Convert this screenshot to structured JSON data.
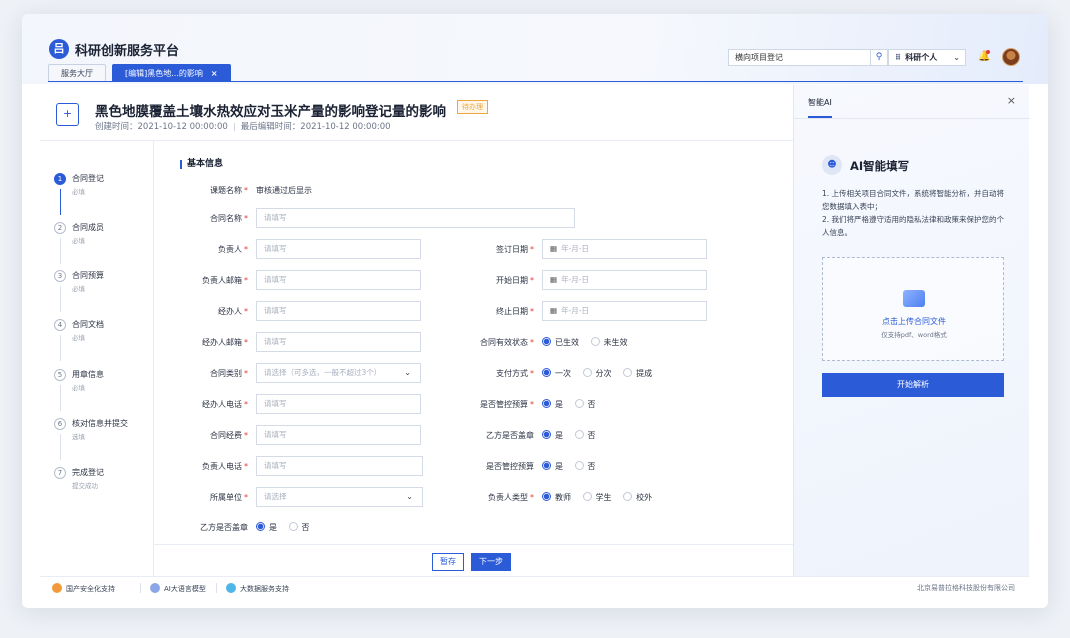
{
  "app": {
    "title": "科研创新服务平台",
    "logo_glyph": "吕"
  },
  "tabs": [
    {
      "label": "服务大厅"
    },
    {
      "label": "[编辑]黑色地...的影响",
      "close": "×"
    }
  ],
  "header": {
    "search_value": "横向项目登记",
    "search_icon": "search-icon",
    "user_label": "科研个人",
    "grid_glyph": "⠿",
    "chevron": "⌄"
  },
  "page": {
    "title": "黑色地膜覆盖土壤水热效应对玉米产量的影响登记量的影响",
    "badge": "待办理",
    "created": "创建时间：2021-10-12 00:00:00",
    "edited": "最后编辑时间：2021-10-12 00:00:00"
  },
  "steps": [
    {
      "num": "1",
      "label": "合同登记",
      "sub": "必填"
    },
    {
      "num": "2",
      "label": "合同成员",
      "sub": "必填"
    },
    {
      "num": "3",
      "label": "合同预算",
      "sub": "必填"
    },
    {
      "num": "4",
      "label": "合同文档",
      "sub": "必填"
    },
    {
      "num": "5",
      "label": "用章信息",
      "sub": "必填"
    },
    {
      "num": "6",
      "label": "核对信息并提交",
      "sub": "选填"
    },
    {
      "num": "7",
      "label": "完成登记",
      "sub": "提交成功"
    }
  ],
  "form": {
    "section": "基本信息",
    "req": "*",
    "topic_label": "课题名称",
    "topic_value": "审核通过后显示",
    "contract_name_label": "合同名称",
    "placeholder": "请填写",
    "select_placeholder": "请选择",
    "date_placeholder": "年-月-日",
    "owner_label": "负责人",
    "owner_email_label": "负责人邮箱",
    "handler_label": "经办人",
    "handler_email_label": "经办人邮箱",
    "contract_type_label": "合同类别",
    "contract_type_placeholder": "请选择（可多选，一般不超过3个）",
    "handler_phone_label": "经办人电话",
    "contract_fund_label": "合同经费",
    "owner_phone_label": "负责人电话",
    "unit_label": "所属单位",
    "sign_date_label": "签订日期",
    "start_date_label": "开始日期",
    "end_date_label": "终止日期",
    "status_label": "合同有效状态",
    "status_options": [
      "已生效",
      "未生效"
    ],
    "pay_label": "支付方式",
    "pay_options": [
      "一次",
      "分次",
      "提成"
    ],
    "budget_label": "是否管控预算",
    "yes": "是",
    "no": "否",
    "party_b_seal_label": "乙方是否盖章",
    "owner_type_label": "负责人类型",
    "owner_type_options": [
      "教师",
      "学生",
      "校外"
    ],
    "save_label": "暂存",
    "next_label": "下一步"
  },
  "ai": {
    "tab": "智能AI",
    "close": "×",
    "title": "AI智能填写",
    "desc1": "1. 上传相关项目合同文件，系统将智能分析，并自动将您数据填入表中；",
    "desc2": "2. 我们将严格遵守适用的隐私法律和政策来保护您的个人信息。",
    "upload_main": "点击上传合同文件",
    "upload_sub": "仅支持pdf、word格式",
    "parse_label": "开始解析"
  },
  "footer": {
    "items": [
      "国产安全化支持",
      "AI大语言模型",
      "大数据服务支持"
    ],
    "company": "北京易普拉格科技股份有限公司"
  },
  "colors": {
    "accent": "#2c5bd8",
    "badge": "#f0a640",
    "required": "#e53935"
  }
}
